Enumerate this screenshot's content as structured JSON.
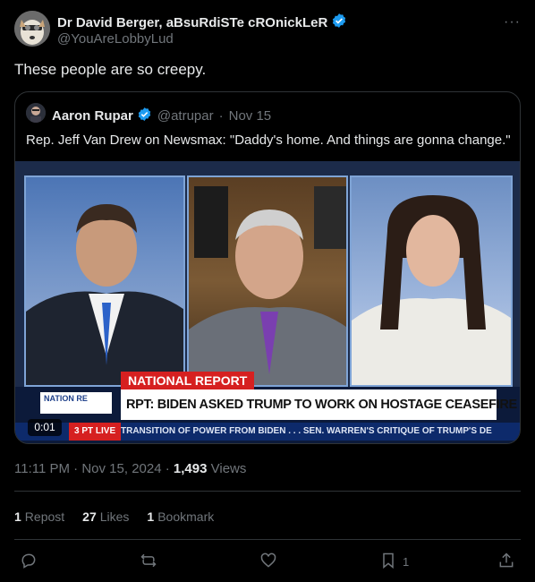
{
  "author": {
    "display_name": "Dr David Berger, aBsuRdiSTe cROnickLeR",
    "handle": "@YouAreLobbyLud",
    "verified_icon": "verified-badge-icon"
  },
  "more_label": "···",
  "tweet_text": "These people are so creepy.",
  "quoted": {
    "display_name": "Aaron Rupar",
    "handle": "@atrupar",
    "separator": "·",
    "date": "Nov 15",
    "text": "Rep. Jeff Van Drew on Newsmax: \"Daddy's home. And things are gonna change.\"",
    "media": {
      "bug_label": "NATIONAL REPORT",
      "headline": "RPT: BIDEN ASKED TRUMP TO WORK ON HOSTAGE CEASEFIRE DEAL",
      "logo_text": "NATION RE",
      "live_label": "3 PT  LIVE",
      "ticker_text": "TRANSITION OF POWER FROM BIDEN . . .     SEN. WARREN'S CRITIQUE OF TRUMP'S DE",
      "timer": "0:01"
    }
  },
  "meta": {
    "time": "11:11 PM",
    "separator": "·",
    "date": "Nov 15, 2024",
    "separator2": "·",
    "views_count": "1,493",
    "views_label": "Views"
  },
  "stats": {
    "reposts_count": "1",
    "reposts_label": "Repost",
    "likes_count": "27",
    "likes_label": "Likes",
    "bookmarks_count": "1",
    "bookmarks_label": "Bookmark"
  },
  "actions": {
    "bookmark_count": "1",
    "reply_icon": "reply-icon",
    "repost_icon": "repost-icon",
    "like_icon": "heart-icon",
    "bookmark_icon": "bookmark-icon",
    "share_icon": "share-icon"
  },
  "colors": {
    "background": "#000000",
    "text": "#e7e9ea",
    "muted": "#71767b",
    "verified": "#1d9bf0",
    "border": "#2f3336"
  }
}
